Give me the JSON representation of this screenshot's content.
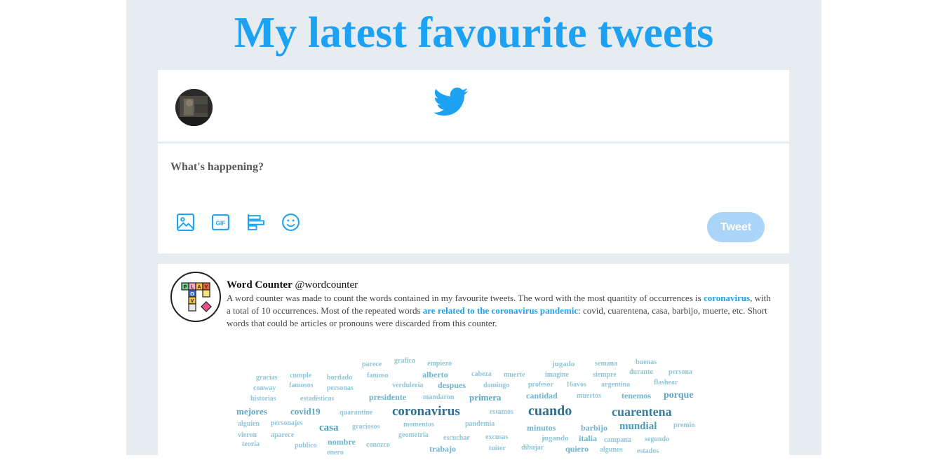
{
  "page": {
    "title": "My latest favourite tweets"
  },
  "header": {
    "bird_icon": "twitter-bird-icon",
    "brand_color": "#1da1f2"
  },
  "compose": {
    "placeholder": "What's happening?",
    "tools": [
      "image-icon",
      "gif-icon",
      "poll-icon",
      "emoji-icon"
    ],
    "gif_label": "GIF",
    "tweet_button": "Tweet"
  },
  "tweet": {
    "name": "Word Counter",
    "handle": "@wordcounter",
    "logo_letters": [
      "P",
      "L",
      "A",
      "Y",
      "O",
      "V"
    ],
    "text_1": "A word counter was made to count the words contained in my favourite tweets. The word with the most quantity of occurrences is ",
    "hl_1": "coronavirus",
    "text_2": ", with a total of 10 occurrences. Most of the repeated words ",
    "hl_2": "are related to the coronavirus pandemic",
    "text_3": ": covid, cuarentena, casa, barbijo, muerte, etc. Short words that could be articles or pronouns were discarded from this counter."
  },
  "word_cloud": [
    {
      "w": "parece",
      "c": "#8fc6d8"
    },
    {
      "w": "grafico",
      "c": "#8fc6d8"
    },
    {
      "w": "empiezo",
      "c": "#8fc6d8"
    },
    {
      "w": "jugado",
      "c": "#8fc6d8"
    },
    {
      "w": "semana",
      "c": "#8fc6d8"
    },
    {
      "w": "buenas",
      "c": "#8fc6d8"
    },
    {
      "w": "gracias",
      "c": "#8fc6d8"
    },
    {
      "w": "cumple",
      "c": "#8fc6d8"
    },
    {
      "w": "bordado",
      "c": "#8fc6d8"
    },
    {
      "w": "famoso",
      "c": "#8fc6d8"
    },
    {
      "w": "alberto",
      "c": "#6db4ce"
    },
    {
      "w": "cabeza",
      "c": "#8fc6d8"
    },
    {
      "w": "muerte",
      "c": "#8fc6d8"
    },
    {
      "w": "imagine",
      "c": "#8fc6d8"
    },
    {
      "w": "siempre",
      "c": "#8fc6d8"
    },
    {
      "w": "durante",
      "c": "#8fc6d8"
    },
    {
      "w": "persona",
      "c": "#8fc6d8"
    },
    {
      "w": "conway",
      "c": "#8fc6d8"
    },
    {
      "w": "famosos",
      "c": "#8fc6d8"
    },
    {
      "w": "personas",
      "c": "#8fc6d8"
    },
    {
      "w": "verduleria",
      "c": "#8fc6d8"
    },
    {
      "w": "despues",
      "c": "#6db4ce"
    },
    {
      "w": "domingo",
      "c": "#8fc6d8"
    },
    {
      "w": "profesor",
      "c": "#8fc6d8"
    },
    {
      "w": "16avos",
      "c": "#8fc6d8"
    },
    {
      "w": "argentina",
      "c": "#8fc6d8"
    },
    {
      "w": "flashear",
      "c": "#8fc6d8"
    },
    {
      "w": "historias",
      "c": "#8fc6d8"
    },
    {
      "w": "estadisticas",
      "c": "#8fc6d8"
    },
    {
      "w": "presidente",
      "c": "#6db4ce"
    },
    {
      "w": "mandaron",
      "c": "#8fc6d8"
    },
    {
      "w": "primera",
      "c": "#5aa9c4"
    },
    {
      "w": "cantidad",
      "c": "#6db4ce"
    },
    {
      "w": "muertos",
      "c": "#8fc6d8"
    },
    {
      "w": "tenemos",
      "c": "#6db4ce"
    },
    {
      "w": "porque",
      "c": "#5aa9c4"
    },
    {
      "w": "mejores",
      "c": "#5aa9c4"
    },
    {
      "w": "covid19",
      "c": "#5aa9c4"
    },
    {
      "w": "quarantine",
      "c": "#8fc6d8"
    },
    {
      "w": "coronavirus",
      "c": "#2f6f8f"
    },
    {
      "w": "estamos",
      "c": "#8fc6d8"
    },
    {
      "w": "cuando",
      "c": "#2f6f8f"
    },
    {
      "w": "cuarentena",
      "c": "#3a7fa0"
    },
    {
      "w": "alguien",
      "c": "#8fc6d8"
    },
    {
      "w": "personajes",
      "c": "#8fc6d8"
    },
    {
      "w": "casa",
      "c": "#4a9ab8"
    },
    {
      "w": "graciosos",
      "c": "#8fc6d8"
    },
    {
      "w": "momentos",
      "c": "#8fc6d8"
    },
    {
      "w": "pandemia",
      "c": "#8fc6d8"
    },
    {
      "w": "minutos",
      "c": "#6db4ce"
    },
    {
      "w": "barbijo",
      "c": "#6db4ce"
    },
    {
      "w": "mundial",
      "c": "#4a9ab8"
    },
    {
      "w": "premio",
      "c": "#8fc6d8"
    },
    {
      "w": "vieron",
      "c": "#8fc6d8"
    },
    {
      "w": "aparece",
      "c": "#8fc6d8"
    },
    {
      "w": "geometria",
      "c": "#8fc6d8"
    },
    {
      "w": "escuchar",
      "c": "#8fc6d8"
    },
    {
      "w": "excusas",
      "c": "#8fc6d8"
    },
    {
      "w": "jugando",
      "c": "#8fc6d8"
    },
    {
      "w": "italia",
      "c": "#6db4ce"
    },
    {
      "w": "campana",
      "c": "#8fc6d8"
    },
    {
      "w": "segundo",
      "c": "#8fc6d8"
    },
    {
      "w": "teoria",
      "c": "#8fc6d8"
    },
    {
      "w": "publico",
      "c": "#8fc6d8"
    },
    {
      "w": "nombre",
      "c": "#6db4ce"
    },
    {
      "w": "conozco",
      "c": "#8fc6d8"
    },
    {
      "w": "trabajo",
      "c": "#6db4ce"
    },
    {
      "w": "tuiter",
      "c": "#8fc6d8"
    },
    {
      "w": "dibujar",
      "c": "#8fc6d8"
    },
    {
      "w": "quiero",
      "c": "#6db4ce"
    },
    {
      "w": "algunos",
      "c": "#8fc6d8"
    },
    {
      "w": "estados",
      "c": "#8fc6d8"
    },
    {
      "w": "enero",
      "c": "#8fc6d8"
    }
  ]
}
